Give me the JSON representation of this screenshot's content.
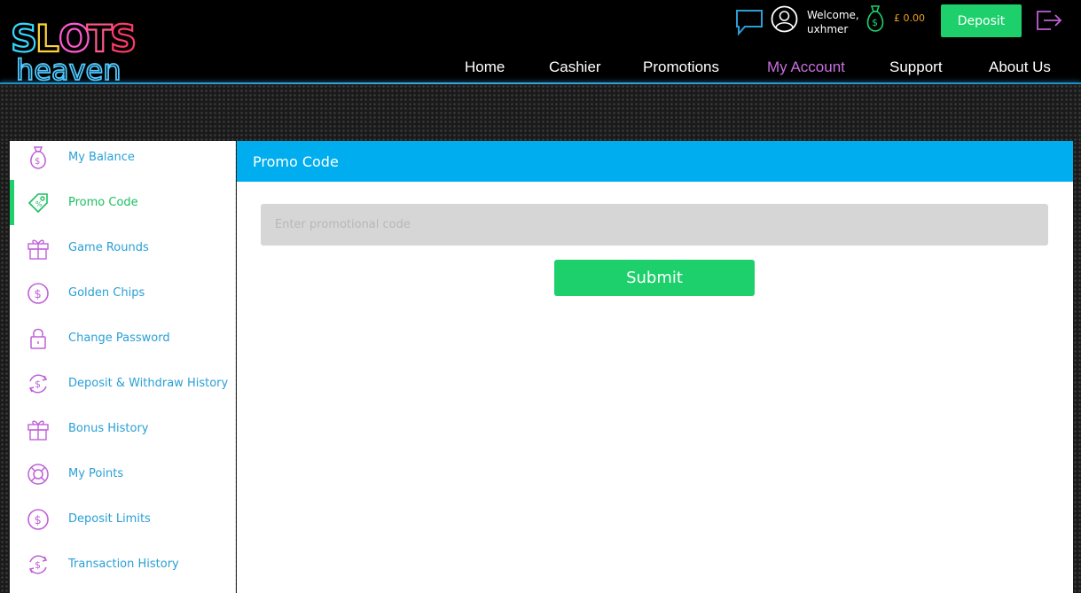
{
  "brand": {
    "logo_word_1": "SLOTS",
    "logo_word_2": "heaven"
  },
  "topbar": {
    "chat_icon": "chat-bubble-icon",
    "user_icon": "user-avatar-icon",
    "welcome_text": "Welcome,",
    "username": "uxhmer",
    "wallet_icon": "money-bag-icon",
    "balance": "£ 0.00",
    "deposit_label": "Deposit",
    "logout_icon": "logout-icon"
  },
  "nav": {
    "items": [
      {
        "label": "Home",
        "active": false
      },
      {
        "label": "Cashier",
        "active": false
      },
      {
        "label": "Promotions",
        "active": false
      },
      {
        "label": "My Account",
        "active": true
      },
      {
        "label": "Support",
        "active": false
      },
      {
        "label": "About Us",
        "active": false
      }
    ]
  },
  "sidebar": {
    "items": [
      {
        "label": "My Balance",
        "icon": "money-bag-icon",
        "active": false
      },
      {
        "label": "Promo Code",
        "icon": "tag-icon",
        "active": true
      },
      {
        "label": "Game Rounds",
        "icon": "gift-icon",
        "active": false
      },
      {
        "label": "Golden Chips",
        "icon": "dollar-coin-icon",
        "active": false
      },
      {
        "label": "Change Password",
        "icon": "lock-icon",
        "active": false
      },
      {
        "label": "Deposit & Withdraw History",
        "icon": "dollar-cycle-icon",
        "active": false
      },
      {
        "label": "Bonus History",
        "icon": "gift-icon",
        "active": false
      },
      {
        "label": "My Points",
        "icon": "lifebuoy-icon",
        "active": false
      },
      {
        "label": "Deposit Limits",
        "icon": "dollar-coin-icon",
        "active": false
      },
      {
        "label": "Transaction History",
        "icon": "dollar-cycle-icon",
        "active": false
      }
    ]
  },
  "main": {
    "title": "Promo Code",
    "input_placeholder": "Enter promotional code",
    "input_value": "",
    "submit_label": "Submit"
  },
  "colors": {
    "accent_green": "#1dd06b",
    "header_blue": "#00aef0",
    "link_blue": "#2a9fd6",
    "nav_active": "#c86fe0",
    "icon_purple": "#c060d8",
    "balance_orange": "#f0a020"
  }
}
